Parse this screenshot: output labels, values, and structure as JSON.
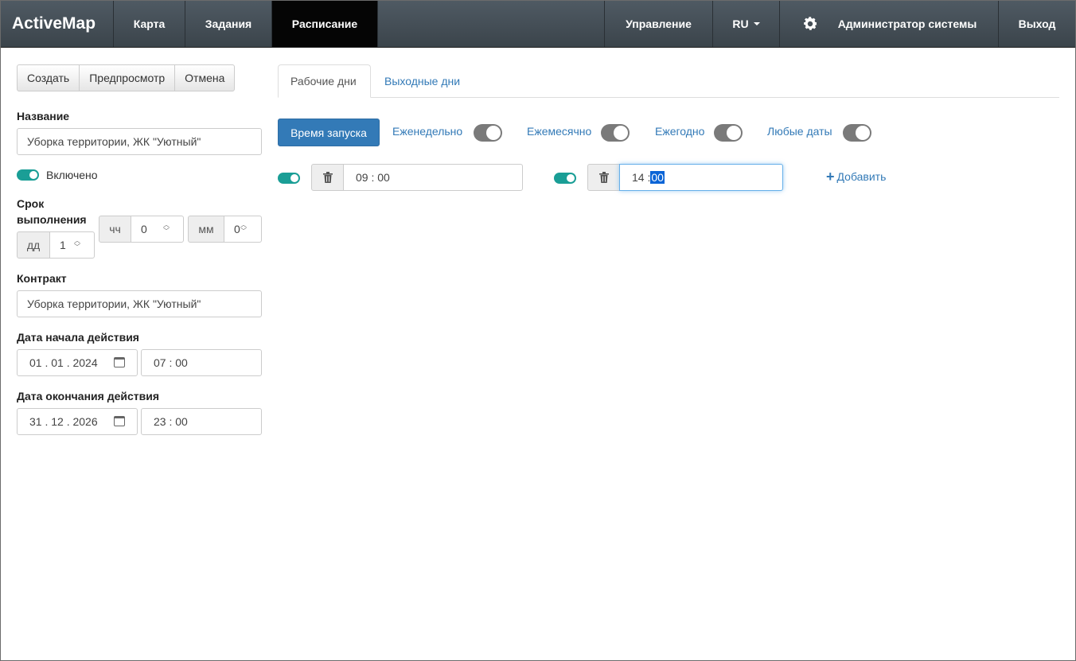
{
  "nav": {
    "brand": "ActiveMap",
    "items": [
      "Карта",
      "Задания",
      "Расписание"
    ],
    "manage": "Управление",
    "lang": "RU",
    "user": "Администратор системы",
    "logout": "Выход"
  },
  "toolbar": {
    "create": "Создать",
    "preview": "Предпросмотр",
    "cancel": "Отмена"
  },
  "form": {
    "name_label": "Название",
    "name_value": "Уборка территории, ЖК \"Уютный\"",
    "enabled_label": "Включено",
    "deadline_label_1": "Срок",
    "deadline_label_2": "выполнения",
    "dd_label": "дд",
    "dd_value": "1",
    "hh_label": "чч",
    "hh_value": "0",
    "mm_label": "мм",
    "mm_value": "0",
    "contract_label": "Контракт",
    "contract_value": "Уборка территории, ЖК \"Уютный\"",
    "start_label": "Дата начала действия",
    "start_date": "01 . 01 . 2024",
    "start_time": "07 : 00",
    "end_label": "Дата окончания действия",
    "end_date": "31 . 12 . 2026",
    "end_time": "23 : 00"
  },
  "tabs": {
    "workdays": "Рабочие дни",
    "weekends": "Выходные дни"
  },
  "schedule": {
    "launch_time": "Время запуска",
    "weekly": "Еженедельно",
    "monthly": "Ежемесячно",
    "yearly": "Ежегодно",
    "any_dates": "Любые даты",
    "time1": "09 : 00",
    "time2_h": "14 :",
    "time2_m": "00",
    "add": "Добавить"
  },
  "colors": {
    "navbar": "#3b444b",
    "active_nav": "#050505",
    "primary": "#337ab7",
    "toggle_on": "#1a9e96",
    "toggle_off": "#7a7a7a"
  }
}
